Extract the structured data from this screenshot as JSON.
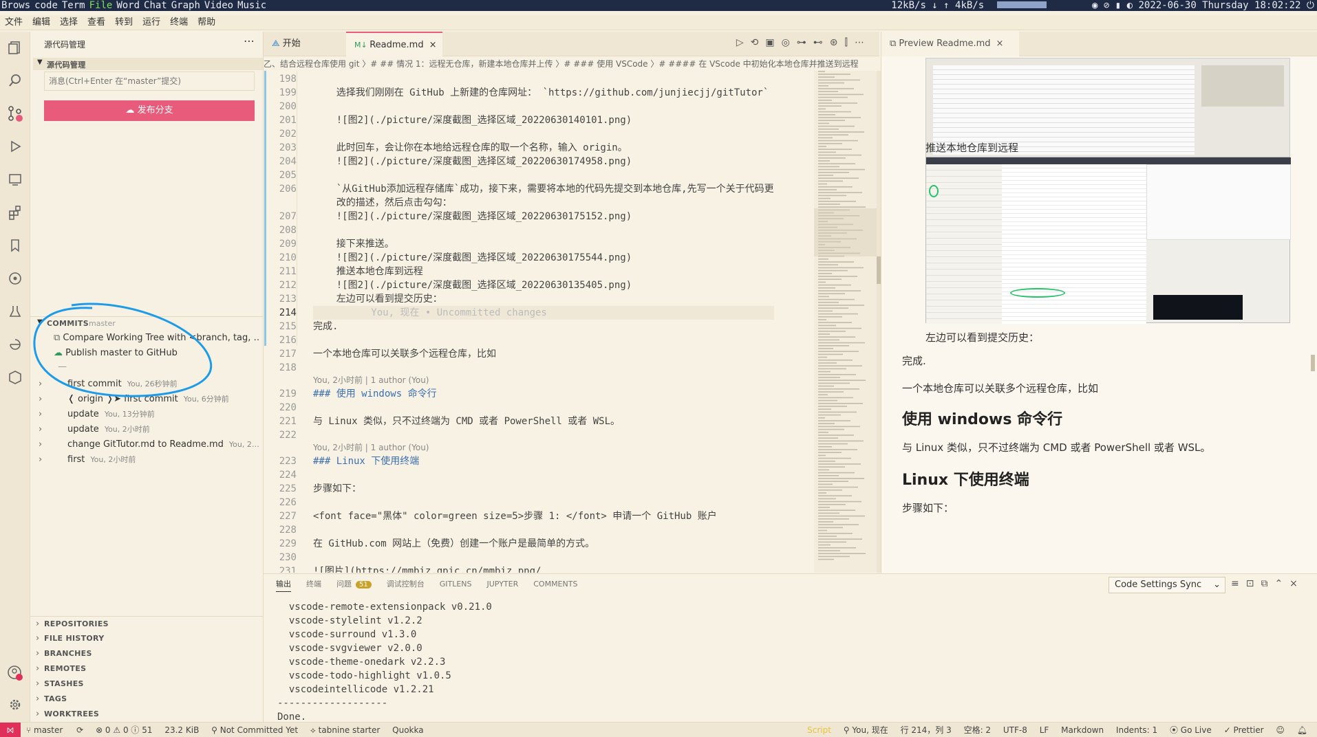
{
  "system_bar": {
    "items": [
      "Brows",
      "code",
      "Term",
      "File",
      "Word",
      "Chat",
      "Graph",
      "Video",
      "Music"
    ],
    "net": "12kB/s ↓  ↑ 4kB/s",
    "datetime": "2022-06-30 Thursday 18:02:22"
  },
  "menu": [
    "文件",
    "编辑",
    "选择",
    "查看",
    "转到",
    "运行",
    "终端",
    "帮助"
  ],
  "sidebar": {
    "title": "源代码管理",
    "scm_section": "源代码管理",
    "message_placeholder": "消息(Ctrl+Enter 在“master”提交)",
    "publish_button": "发布分支",
    "commits_title": "COMMITS",
    "commits_branch": "master",
    "compare_item": "Compare Working Tree with <branch, tag, …",
    "publish_item": "Publish master to GitHub",
    "divider": "—",
    "commits": [
      {
        "msg": "first commit",
        "meta": "You, 26秒钟前"
      },
      {
        "msg": "❬ origin ❭➤ first commit",
        "meta": "You, 6分钟前"
      },
      {
        "msg": "update",
        "meta": "You, 13分钟前"
      },
      {
        "msg": "update",
        "meta": "You, 2小时前"
      },
      {
        "msg": "change GitTutor.md to Readme.md",
        "meta": "You, 2…"
      },
      {
        "msg": "first",
        "meta": "You, 2小时前"
      }
    ],
    "bottom_sections": [
      "REPOSITORIES",
      "FILE HISTORY",
      "BRANCHES",
      "REMOTES",
      "STASHES",
      "TAGS",
      "WORKTREES"
    ]
  },
  "editor": {
    "tabs": [
      {
        "label": "开始",
        "icon": "vscode-icon"
      },
      {
        "label": "Readme.md",
        "icon": "markdown-icon",
        "active": true
      }
    ],
    "breadcrumb": "乙、结合远程仓库使用 git 〉# ## 情况 1：远程无仓库，新建本地仓库并上传 〉# ### 使用 VSCode 〉# #### 在 VScode 中初始化本地仓库并推送到远程",
    "lines": [
      {
        "n": "198",
        "t": ""
      },
      {
        "n": "199",
        "t": "    选择我们刚刚在 GitHub 上新建的仓库网址： `https://github.com/junjiecjj/gitTutor`"
      },
      {
        "n": "200",
        "t": ""
      },
      {
        "n": "201",
        "t": "    ![图2](./picture/深度截图_选择区域_20220630140101.png)"
      },
      {
        "n": "202",
        "t": ""
      },
      {
        "n": "203",
        "t": "    此时回车，会让你在本地给远程仓库的取一个名称，输入 origin。"
      },
      {
        "n": "204",
        "t": "    ![图2](./picture/深度截图_选择区域_20220630174958.png)"
      },
      {
        "n": "205",
        "t": ""
      },
      {
        "n": "206",
        "t": "    `从GitHub添加远程存储库`成功，接下来，需要将本地的代码先提交到本地仓库,先写一个关于代码更"
      },
      {
        "n": "",
        "t": "    改的描述，然后点击勾勾："
      },
      {
        "n": "207",
        "t": "    ![图2](./picture/深度截图_选择区域_20220630175152.png)"
      },
      {
        "n": "208",
        "t": ""
      },
      {
        "n": "209",
        "t": "    接下来推送。"
      },
      {
        "n": "210",
        "t": "    ![图2](./picture/深度截图_选择区域_20220630175544.png)"
      },
      {
        "n": "211",
        "t": "    推送本地仓库到远程"
      },
      {
        "n": "212",
        "t": "    ![图2](./picture/深度截图_选择区域_20220630135405.png)"
      },
      {
        "n": "213",
        "t": "    左边可以看到提交历史："
      },
      {
        "n": "214",
        "t": "          You, 现在 • Uncommitted changes"
      },
      {
        "n": "215",
        "t": "完成."
      },
      {
        "n": "216",
        "t": ""
      },
      {
        "n": "217",
        "t": "一个本地仓库可以关联多个远程仓库，比如"
      },
      {
        "n": "218",
        "t": ""
      },
      {
        "n": "",
        "t": "You, 2小时前 | 1 author (You)"
      },
      {
        "n": "219",
        "t": "### 使用 windows 命令行"
      },
      {
        "n": "220",
        "t": ""
      },
      {
        "n": "221",
        "t": "与 Linux 类似，只不过终端为 CMD 或者 PowerShell 或者 WSL。"
      },
      {
        "n": "222",
        "t": ""
      },
      {
        "n": "",
        "t": "You, 2小时前 | 1 author (You)"
      },
      {
        "n": "223",
        "t": "### Linux 下使用终端"
      },
      {
        "n": "224",
        "t": ""
      },
      {
        "n": "225",
        "t": "步骤如下："
      },
      {
        "n": "226",
        "t": ""
      },
      {
        "n": "227",
        "t": "<font face=\"黑体\" color=green size=5>步骤 1: </font> 申请一个 GitHub 账户"
      },
      {
        "n": "228",
        "t": ""
      },
      {
        "n": "229",
        "t": "在 GitHub.com 网站上（免费）创建一个账户是最简单的方式。"
      },
      {
        "n": "230",
        "t": ""
      },
      {
        "n": "231",
        "t": "![图片](https://mmbiz.qpic.cn/mmbiz_png/"
      }
    ]
  },
  "preview": {
    "tab": "Preview Readme.md",
    "img_caption": "推送本地仓库到远程",
    "commit_hint": "左边可以看到提交历史：",
    "done": "完成.",
    "multi_remote": "一个本地仓库可以关联多个远程仓库，比如",
    "h_windows": "使用 windows 命令行",
    "p_windows": "与 Linux 类似，只不过终端为 CMD 或者 PowerShell 或者 WSL。",
    "h_linux": "Linux 下使用终端",
    "steps": "步骤如下："
  },
  "panel": {
    "tabs": [
      "输出",
      "终端",
      "问题",
      "调试控制台",
      "GITLENS",
      "JUPYTER",
      "COMMENTS"
    ],
    "problems_count": "51",
    "select": "Code Settings Sync",
    "output": [
      "  vscode-remote-extensionpack v0.21.0",
      "  vscode-stylelint v1.2.2",
      "  vscode-surround v1.3.0",
      "  vscode-svgviewer v2.0.0",
      "  vscode-theme-onedark v2.2.3",
      "  vscode-todo-highlight v1.0.5",
      "  vscodeintellicode v1.2.21",
      "-------------------",
      "Done."
    ]
  },
  "status": {
    "branch": "master",
    "problems": "⊗ 0 ⚠ 0 ⓘ 51",
    "size": "23.2 KiB",
    "committed": "Not Committed Yet",
    "tabnine": "tabnine starter",
    "quokka": "Quokka",
    "script": "Script",
    "blame": "You, 现在",
    "position": "行 214，列 3",
    "spaces": "空格: 2",
    "encoding": "UTF-8",
    "eol": "LF",
    "language": "Markdown",
    "indents": "Indents: 1",
    "golive": "Go Live",
    "prettier": "✓ Prettier"
  },
  "colors": {
    "accent": "#e85b7a",
    "annotation": "#1e9be8",
    "status_remote": "#e0305a"
  }
}
